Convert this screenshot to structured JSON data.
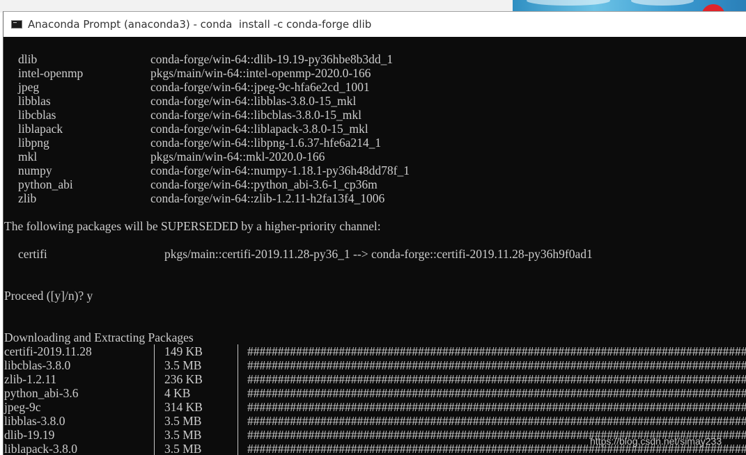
{
  "window": {
    "title": "Anaconda Prompt (anaconda3) - conda  install -c conda-forge dlib"
  },
  "packages": [
    {
      "name": "dlib",
      "spec": "conda-forge/win-64::dlib-19.19-py36hbe8b3dd_1"
    },
    {
      "name": "intel-openmp",
      "spec": "pkgs/main/win-64::intel-openmp-2020.0-166"
    },
    {
      "name": "jpeg",
      "spec": "conda-forge/win-64::jpeg-9c-hfa6e2cd_1001"
    },
    {
      "name": "libblas",
      "spec": "conda-forge/win-64::libblas-3.8.0-15_mkl"
    },
    {
      "name": "libcblas",
      "spec": "conda-forge/win-64::libcblas-3.8.0-15_mkl"
    },
    {
      "name": "liblapack",
      "spec": "conda-forge/win-64::liblapack-3.8.0-15_mkl"
    },
    {
      "name": "libpng",
      "spec": "conda-forge/win-64::libpng-1.6.37-hfe6a214_1"
    },
    {
      "name": "mkl",
      "spec": "pkgs/main/win-64::mkl-2020.0-166"
    },
    {
      "name": "numpy",
      "spec": "conda-forge/win-64::numpy-1.18.1-py36h48dd78f_1"
    },
    {
      "name": "python_abi",
      "spec": "conda-forge/win-64::python_abi-3.6-1_cp36m"
    },
    {
      "name": "zlib",
      "spec": "conda-forge/win-64::zlib-1.2.11-h2fa13f4_1006"
    }
  ],
  "superseded": {
    "heading": "The following packages will be SUPERSEDED by a higher-priority channel:",
    "name": "certifi",
    "spec": "pkgs/main::certifi-2019.11.28-py36_1 --> conda-forge::certifi-2019.11.28-py36h9f0ad1"
  },
  "prompt": {
    "text": "Proceed ([y]/n)? y"
  },
  "downloads": {
    "heading": "Downloading and Extracting Packages",
    "bar_text": "#####################################################################################################",
    "items": [
      {
        "name": "certifi-2019.11.28",
        "size": "149 KB"
      },
      {
        "name": "libcblas-3.8.0",
        "size": "3.5 MB"
      },
      {
        "name": "zlib-1.2.11",
        "size": "236 KB"
      },
      {
        "name": "python_abi-3.6",
        "size": "4 KB"
      },
      {
        "name": "jpeg-9c",
        "size": "314 KB"
      },
      {
        "name": "libblas-3.8.0",
        "size": "3.5 MB"
      },
      {
        "name": "dlib-19.19",
        "size": "3.5 MB"
      },
      {
        "name": "liblapack-3.8.0",
        "size": "3.5 MB"
      }
    ]
  },
  "watermark": "https://blog.csdn.net/simay233"
}
